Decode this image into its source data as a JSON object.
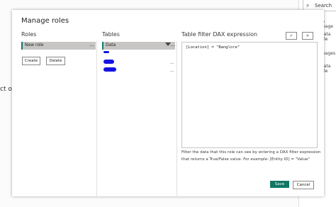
{
  "background": {
    "search_label": "Search",
    "side_items": [
      "s page",
      "lata fie",
      "pages",
      "lata fie"
    ],
    "left_fragment": "ct or"
  },
  "dialog": {
    "title": "Manage roles",
    "roles": {
      "heading": "Roles",
      "items": [
        {
          "label": "New role",
          "more": "..."
        }
      ],
      "create_label": "Create",
      "delete_label": "Delete"
    },
    "tables": {
      "heading": "Tables",
      "selected": "Data",
      "more": "...",
      "row_more": "..."
    },
    "dax": {
      "heading": "Table filter DAX expression",
      "check_label": "✓",
      "expand_label": "»",
      "expression": "[Location] = \"Banglore\"",
      "help_text": "Filter the data that this role can see by entering a DAX filter expression that returns a True/False value. For example: [Entity ID] = \"Value\""
    },
    "save_label": "Save",
    "cancel_label": "Cancel"
  },
  "colors": {
    "accent": "#117865",
    "selection": "#c8c6c4",
    "redaction": "#1515e0"
  }
}
